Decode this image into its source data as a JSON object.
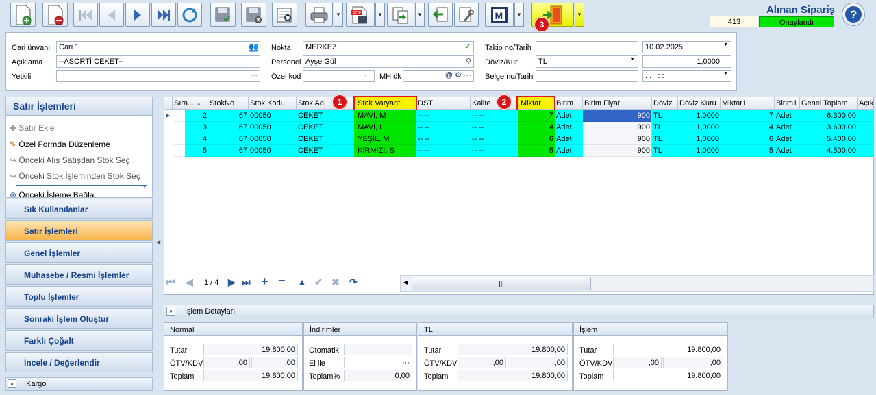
{
  "header": {
    "title": "Alınan Sipariş",
    "doc_number": "413",
    "status": "Onaylandı"
  },
  "badges": {
    "b1": "1",
    "b2": "2",
    "b3": "3"
  },
  "form": {
    "cari_label": "Cari ünvanı",
    "cari_value": "Cari 1",
    "aciklama_label": "Açıklama",
    "aciklama_value": "--ASORTİ CEKET--",
    "yetkili_label": "Yetkili",
    "nokta_label": "Nokta",
    "nokta_value": "MERKEZ",
    "personel_label": "Personel",
    "personel_value": "Ayşe Gül",
    "ozelkod_label": "Özel kod",
    "mhok_label": "MH ök",
    "takip_label": "Takip no/Tarih",
    "takip_date": "10.02.2025",
    "doviz_label": "Döviz/Kur",
    "doviz_value": "TL",
    "kur_value": "1,0000",
    "belge_label": "Belge no/Tarih",
    "belge_time": ". .   : :"
  },
  "left_panel": {
    "title": "Satır İşlemleri",
    "items": [
      "Satır Ekle",
      "Özel Formda Düzenleme",
      "Önceki Alış Satışdan Stok Seç",
      "Önceki Stok İşleminden Stok Seç",
      "Önceki İşleme Bağla"
    ],
    "accordion": [
      "Sık Kullanılanlar",
      "Satır İşlemleri",
      "Genel İşlemler",
      "Muhasebe / Resmi İşlemler",
      "Toplu İşlemler",
      "Sonraki İşlem Oluştur",
      "Farklı Çoğalt",
      "İncele / Değerlendir"
    ],
    "kargo": "Kargo"
  },
  "grid": {
    "columns": [
      "Sıra...",
      "StokNo",
      "Stok Kodu",
      "Stok Adı",
      "Stok Varyantı",
      "DST",
      "Kalite",
      "Miktar",
      "Birim",
      "Birim Fiyat",
      "Döviz",
      "Döviz Kuru",
      "Miktar1",
      "Birim1",
      "Genel Toplam",
      "Açık"
    ],
    "rows": [
      {
        "sira": "2",
        "stokno": "67",
        "kod": "00050",
        "ad": "CEKET",
        "varyant": "MAVİ, M",
        "dst": "-- --",
        "kalite": "-- --",
        "miktar": "7",
        "birim": "Adet",
        "fiyat": "900",
        "doviz": "TL",
        "kur": "1,0000",
        "miktar1": "7",
        "birim1": "Adet",
        "toplam": "6.300,00"
      },
      {
        "sira": "3",
        "stokno": "67",
        "kod": "00050",
        "ad": "CEKET",
        "varyant": "MAVİ, L",
        "dst": "-- --",
        "kalite": "-- --",
        "miktar": "4",
        "birim": "Adet",
        "fiyat": "900",
        "doviz": "TL",
        "kur": "1,0000",
        "miktar1": "4",
        "birim1": "Adet",
        "toplam": "3.600,00"
      },
      {
        "sira": "4",
        "stokno": "67",
        "kod": "00050",
        "ad": "CEKET",
        "varyant": "YEŞİL, M",
        "dst": "-- --",
        "kalite": "-- --",
        "miktar": "6",
        "birim": "Adet",
        "fiyat": "900",
        "doviz": "TL",
        "kur": "1,0000",
        "miktar1": "6",
        "birim1": "Adet",
        "toplam": "5.400,00"
      },
      {
        "sira": "5",
        "stokno": "67",
        "kod": "00050",
        "ad": "CEKET",
        "varyant": "KIRMIZI, S",
        "dst": "-- --",
        "kalite": "-- --",
        "miktar": "5",
        "birim": "Adet",
        "fiyat": "900",
        "doviz": "TL",
        "kur": "1,0000",
        "miktar1": "5",
        "birim1": "Adet",
        "toplam": "4.500,00"
      }
    ],
    "pager": "1 / 4"
  },
  "details": {
    "title": "İşlem Detayları",
    "normal": {
      "head": "Normal",
      "tutar_l": "Tutar",
      "tutar": "19.800,00",
      "otv_l": "ÖTV/KDV",
      "otv1": ",00",
      "otv2": ",00",
      "toplam_l": "Toplam",
      "toplam": "19.800,00"
    },
    "indirim": {
      "head": "İndirimler",
      "oto_l": "Otomatik",
      "elile_l": "El ile",
      "toplamp_l": "Toplam%",
      "toplamp": "0,00"
    },
    "tl": {
      "head": "TL",
      "tutar_l": "Tutar",
      "tutar": "19.800,00",
      "otv_l": "ÖTV/KDV",
      "otv1": ",00",
      "otv2": ",00",
      "toplam_l": "Toplam",
      "toplam": "19.800,00"
    },
    "islem": {
      "head": "İşlem",
      "tutar_l": "Tutar",
      "tutar": "19.800,00",
      "otv_l": "ÖTV/KDV",
      "otv1": ",00",
      "otv2": ",00",
      "toplam_l": "Toplam",
      "toplam": "19.800,00"
    }
  },
  "colors": {
    "cyan_row": "#00ffff",
    "green_highlight": "#00e600",
    "status_green": "#00e600",
    "badge_red": "#d8141b"
  }
}
